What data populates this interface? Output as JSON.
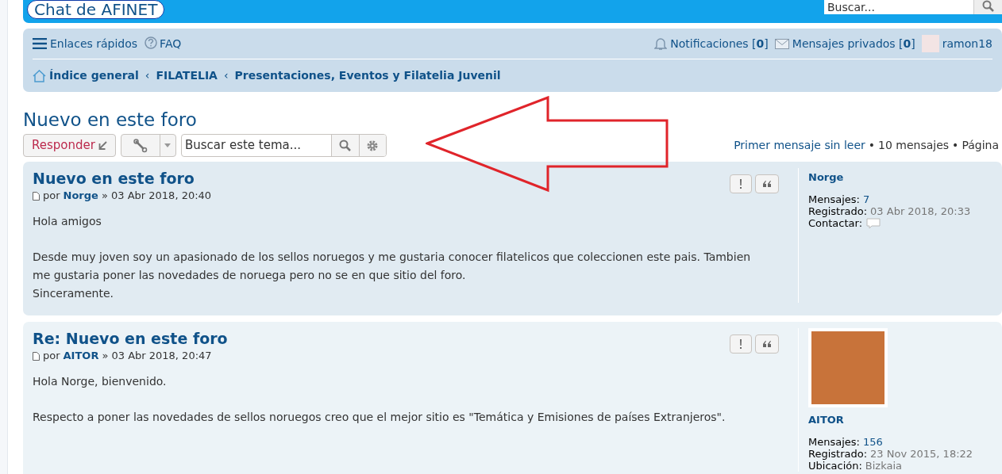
{
  "header": {
    "logo": "Chat de AFINET",
    "search": {
      "placeholder": "Buscar..."
    }
  },
  "nav": {
    "quick_links": "Enlaces rápidos",
    "faq": "FAQ",
    "notifications": "Notificaciones [**0**]",
    "messages": "Mensajes privados [**0**]",
    "user": "ramon18",
    "breadcrumb_separator": "‹",
    "breadcrumbs": [
      "Índice general",
      "FILATELIA",
      "Presentaciones, Eventos y Filatelia Juvenil"
    ]
  },
  "topic": {
    "title": "Nuevo en este foro",
    "reply_button": "Responder",
    "search": {
      "placeholder": "Buscar este tema..."
    },
    "stats": [
      "Primer mensaje sin leer",
      "10 mensajes",
      "Página"
    ],
    "separator": "•"
  },
  "posts": [
    {
      "title": "Nuevo en este foro",
      "by": "por",
      "author": "Norge",
      "date": "» 03 Abr 2018, 20:40",
      "avatar": false,
      "paragraphs": [
        "Hola amigos",
        "Desde muy joven soy un apasionado de los sellos noruegos y me gustaria conocer filatelicos que coleccionen este pais. Tambien me gustaria poner las novedades de noruega pero no se en que sitio del foro.\nSinceramente."
      ],
      "profile_name": "Norge",
      "profile": [
        {
          "kind": "link",
          "label": "Mensajes:",
          "value": "7"
        },
        {
          "kind": "date",
          "label": "Registrado:",
          "value": "03 Abr 2018, 20:33"
        },
        {
          "kind": "contact",
          "label": "Contactar:"
        }
      ]
    },
    {
      "title": "Re: Nuevo en este foro",
      "by": "por",
      "author": "AITOR",
      "date": "» 03 Abr 2018, 20:47",
      "avatar": true,
      "paragraphs": [
        "Hola Norge, bienvenido.",
        "Respecto a poner las novedades de sellos noruegos creo que el mejor sitio es \"Temática y Emisiones de países Extranjeros\"."
      ],
      "profile_name": "AITOR",
      "profile": [
        {
          "kind": "link",
          "label": "Mensajes:",
          "value": "156"
        },
        {
          "kind": "date",
          "label": "Registrado:",
          "value": "23 Nov 2015, 18:22"
        },
        {
          "kind": "date",
          "label": "Ubicación:",
          "value": "Bizkaia"
        }
      ]
    }
  ]
}
